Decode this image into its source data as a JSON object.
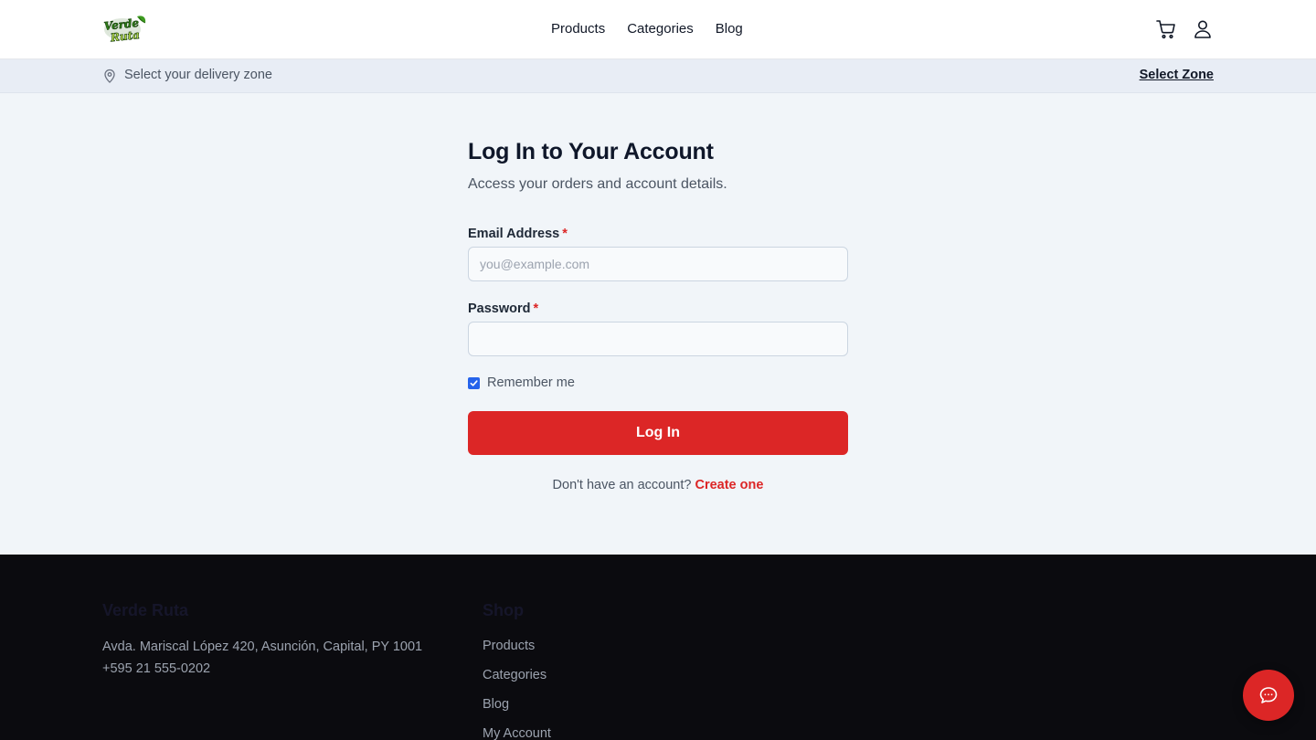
{
  "header": {
    "brand": "Verde Ruta",
    "nav": [
      "Products",
      "Categories",
      "Blog"
    ],
    "icons": [
      "cart-icon",
      "user-icon"
    ]
  },
  "zone": {
    "text": "Select your delivery zone",
    "link": "Select Zone"
  },
  "login": {
    "title": "Log In to Your Account",
    "subtitle": "Access your orders and account details.",
    "email_label": "Email Address",
    "email_placeholder": "you@example.com",
    "email_value": "",
    "password_label": "Password",
    "password_value": "",
    "required_mark": "*",
    "remember_label": "Remember me",
    "remember_checked": true,
    "button": "Log In",
    "no_account": "Don't have an account?",
    "create_link": "Create one"
  },
  "footer": {
    "brand": "Verde Ruta",
    "address": "Avda. Mariscal López 420, Asunción, Capital, PY 1001",
    "phone": "+595 21 555-0202",
    "shop_title": "Shop",
    "shop_links": [
      "Products",
      "Categories",
      "Blog",
      "My Account"
    ]
  },
  "colors": {
    "accent": "#dc2626",
    "page_bg": "#f1f5f9",
    "footer_bg": "#0b0b0f",
    "checkbox": "#2563eb"
  }
}
